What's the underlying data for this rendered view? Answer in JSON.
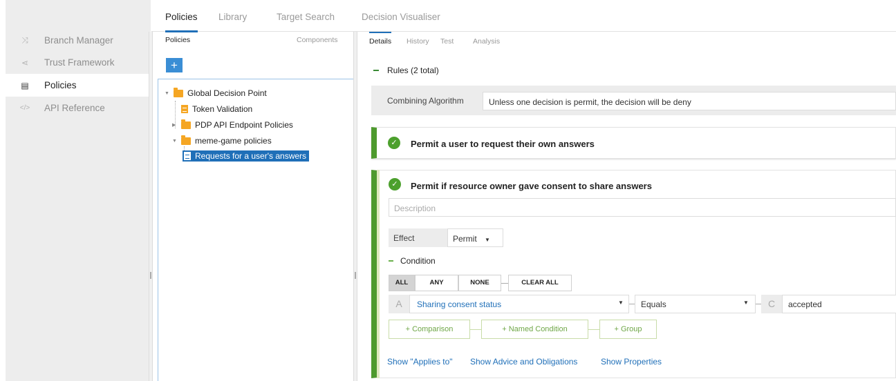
{
  "sidebar": {
    "items": [
      {
        "icon": "branch-icon",
        "glyph": "⤨",
        "label": "Branch Manager"
      },
      {
        "icon": "share-icon",
        "glyph": "⋖",
        "label": "Trust Framework"
      },
      {
        "icon": "document-icon",
        "glyph": "▤",
        "label": "Policies"
      },
      {
        "icon": "code-icon",
        "glyph": "</>",
        "label": "API Reference"
      }
    ]
  },
  "top_tabs": [
    "Policies",
    "Library",
    "Target Search",
    "Decision Visualiser"
  ],
  "left_panel": {
    "tabs": [
      "Policies",
      "Components"
    ],
    "add_label": "+",
    "tree": {
      "root": "Global Decision Point",
      "token": "Token Validation",
      "pdp": "PDP API Endpoint Policies",
      "meme": "meme-game policies",
      "selected": "Requests for a user's answers"
    }
  },
  "details": {
    "tabs": [
      "Details",
      "History",
      "Test",
      "Analysis"
    ],
    "rules_header": "Rules (2 total)",
    "combining_label": "Combining Algorithm",
    "combining_value": "Unless one decision is permit, the decision will be deny",
    "rule1_title": "Permit a user to request their own answers",
    "rule2_title": "Permit if resource owner gave consent to share answers",
    "description_placeholder": "Description",
    "effect_label": "Effect",
    "effect_value": "Permit",
    "condition_label": "Condition",
    "logic_buttons": [
      "ALL",
      "ANY",
      "NONE"
    ],
    "clear_all": "CLEAR ALL",
    "row": {
      "letter_a": "A",
      "attribute": "Sharing consent status",
      "operator": "Equals",
      "letter_c": "C",
      "value": "accepted"
    },
    "add_buttons": [
      "+ Comparison",
      "+ Named Condition",
      "+ Group"
    ],
    "footer_links": [
      "Show \"Applies to\"",
      "Show Advice and Obligations",
      "Show Properties"
    ]
  },
  "colors": {
    "accent": "#1f6fb8",
    "rule_green": "#4e9a2e",
    "folder_orange": "#f5a623"
  }
}
